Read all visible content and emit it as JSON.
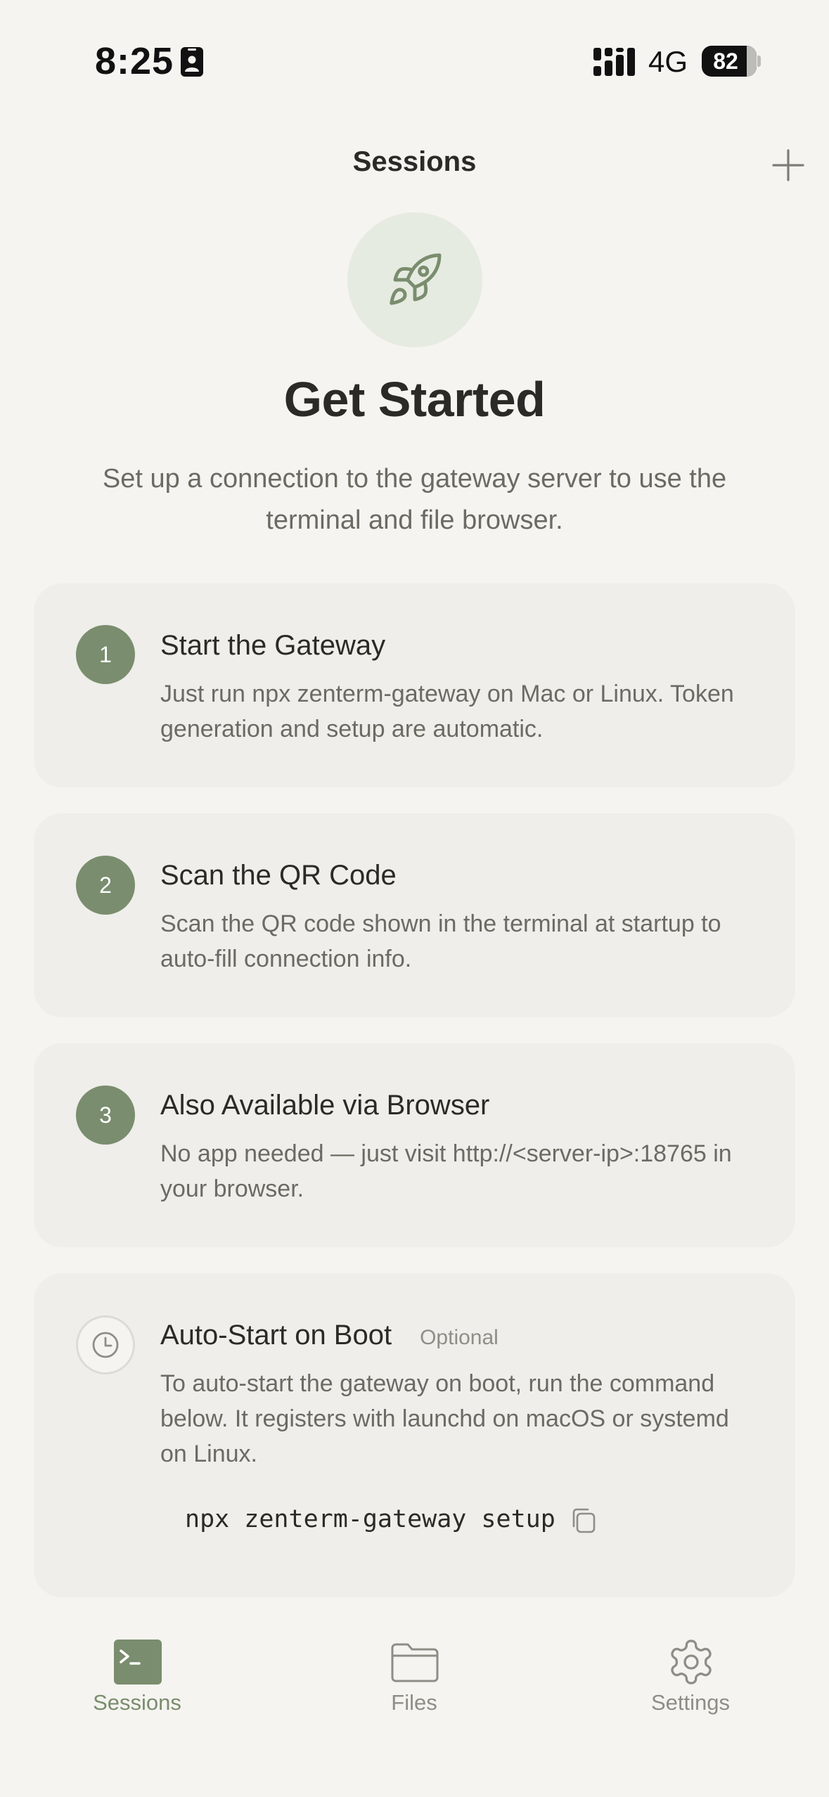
{
  "status_bar": {
    "time": "8:25",
    "network": "4G",
    "battery_level": "82",
    "battery_fraction": 0.82
  },
  "header": {
    "title": "Sessions",
    "add_icon": "plus-icon"
  },
  "hero": {
    "icon": "rocket-icon",
    "title": "Get Started",
    "subtitle": "Set up a connection to the gateway server to use the terminal and file browser."
  },
  "steps": [
    {
      "number": "1",
      "title": "Start the Gateway",
      "description": "Just run npx zenterm-gateway on Mac or Linux. Token generation and setup are automatic."
    },
    {
      "number": "2",
      "title": "Scan the QR Code",
      "description": "Scan the QR code shown in the terminal at startup to auto-fill connection info."
    },
    {
      "number": "3",
      "title": "Also Available via Browser",
      "description": "No app needed — just visit http://<server-ip>:18765 in your browser."
    }
  ],
  "autostart": {
    "icon": "clock-icon",
    "title": "Auto-Start on Boot",
    "tag": "Optional",
    "description": "To auto-start the gateway on boot, run the command below. It registers with launchd on macOS or systemd on Linux.",
    "command": "npx zenterm-gateway setup",
    "copy_icon": "copy-icon"
  },
  "tabs": [
    {
      "label": "Sessions",
      "icon": "terminal-icon",
      "active": true
    },
    {
      "label": "Files",
      "icon": "folder-icon",
      "active": false
    },
    {
      "label": "Settings",
      "icon": "gear-icon",
      "active": false
    }
  ],
  "colors": {
    "background": "#f5f4f0",
    "card": "#efeeea",
    "accent": "#7a8d6e",
    "hero_circle": "#e6ebe1",
    "text_primary": "#2b2a26",
    "text_secondary": "#6b6a63"
  }
}
